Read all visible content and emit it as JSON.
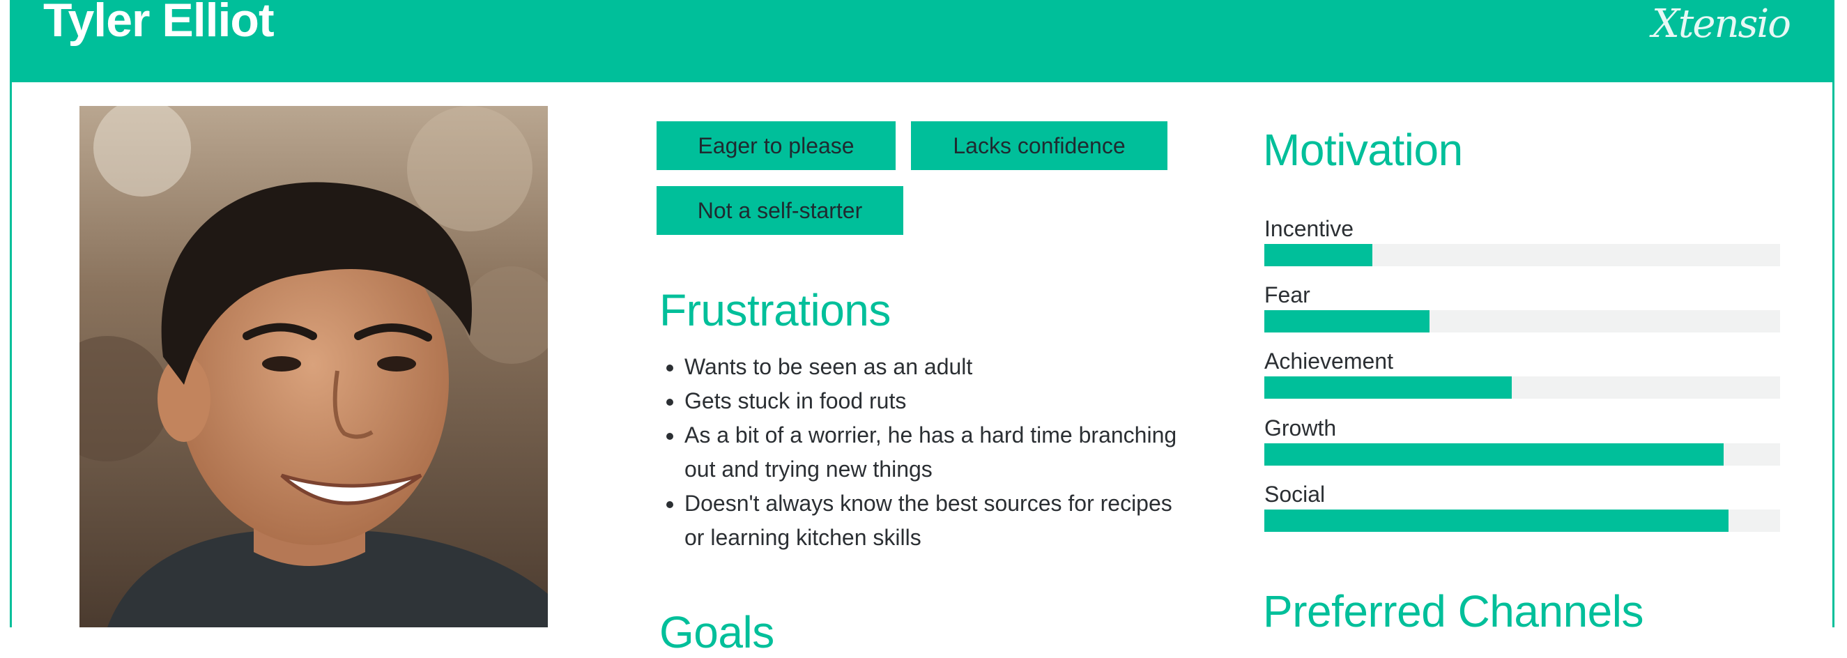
{
  "header": {
    "name": "Tyler Elliot",
    "brand": "Xtensio"
  },
  "traits": [
    "Eager to please",
    "Lacks confidence",
    "Not a self-starter"
  ],
  "frustrations": {
    "heading": "Frustrations",
    "items": [
      "Wants to be seen as an adult",
      "Gets stuck in food ruts",
      "As a bit of a worrier, he has a hard time branching out and trying new things",
      "Doesn't always know the best sources for recipes or learning kitchen skills"
    ]
  },
  "goals": {
    "heading": "Goals"
  },
  "motivation": {
    "heading": "Motivation",
    "items": [
      {
        "label": "Incentive",
        "level": 0.21
      },
      {
        "label": "Fear",
        "level": 0.32
      },
      {
        "label": "Achievement",
        "level": 0.48
      },
      {
        "label": "Growth",
        "level": 0.89
      },
      {
        "label": "Social",
        "level": 0.9
      }
    ]
  },
  "channels": {
    "heading": "Preferred Channels"
  },
  "colors": {
    "accent": "#00bf9a",
    "track": "#f1f2f2",
    "text": "#2b2f33"
  },
  "portrait": {
    "icon": "portrait-photo"
  }
}
